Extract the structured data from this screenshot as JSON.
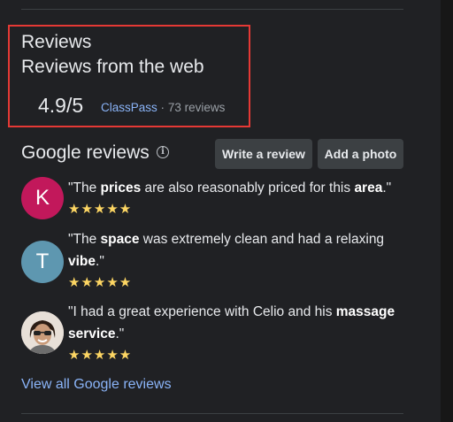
{
  "reviews_header": {
    "title": "Reviews",
    "subtitle": "Reviews from the web",
    "score": "4.9/5",
    "source_name": "ClassPass",
    "separator": "·",
    "review_count": "73 reviews"
  },
  "google_reviews": {
    "title": "Google reviews",
    "info_icon": "ⓘ",
    "write_review_label": "Write a review",
    "add_photo_label": "Add a photo",
    "stars": "★★★★★",
    "items": [
      {
        "initial": "K",
        "avatar_color": "#c2185b",
        "parts": [
          "\"The ",
          "prices",
          " are also reasonably priced for this ",
          "area",
          ".\""
        ],
        "rating": 5
      },
      {
        "initial": "T",
        "avatar_color": "#5e97b0",
        "parts": [
          "\"The ",
          "space",
          " was extremely clean and had a relaxing ",
          "vibe",
          ".\""
        ],
        "rating": 5
      },
      {
        "initial": "",
        "avatar_color": "#d7ccc8",
        "parts": [
          "\"I had a great experience with Celio and his ",
          "massage service",
          ".\""
        ],
        "rating": 5
      }
    ],
    "view_all_label": "View all Google reviews"
  },
  "colors": {
    "panel_bg": "#202124",
    "link": "#8ab4f8",
    "star": "#fdd663",
    "highlight_border": "#e53935"
  }
}
